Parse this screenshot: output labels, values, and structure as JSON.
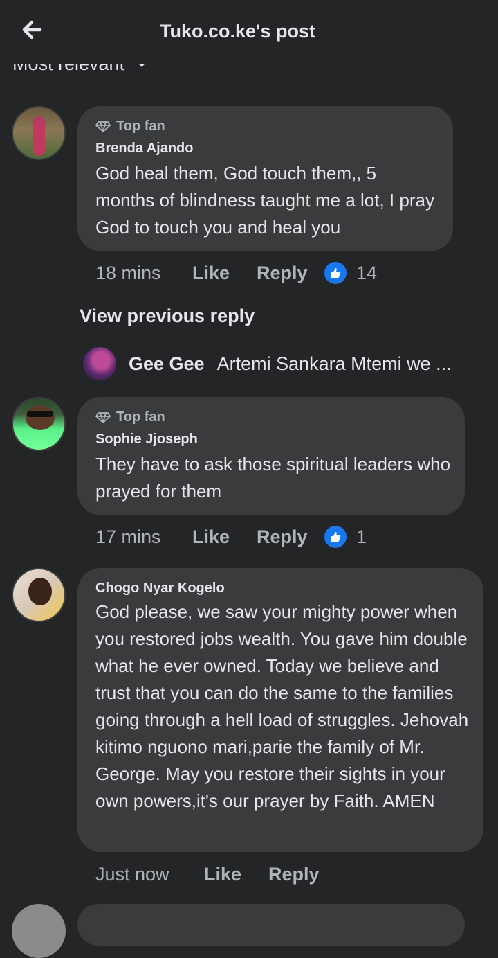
{
  "header": {
    "title": "Tuko.co.ke's post",
    "sort_label": "Most relevant"
  },
  "comments": [
    {
      "badge": "Top fan",
      "author": "Brenda Ajando",
      "text": "God heal them, God touch them,, 5 months of blindness  taught me a lot, I pray God to touch you  and heal you",
      "time": "18 mins",
      "like_label": "Like",
      "reply_label": "Reply",
      "reactions": "14"
    },
    {
      "badge": "Top fan",
      "author": "Sophie Jjoseph",
      "text": "They have to ask those spiritual leaders who prayed for them",
      "time": "17 mins",
      "like_label": "Like",
      "reply_label": "Reply",
      "reactions": "1"
    },
    {
      "author": "Chogo Nyar Kogelo",
      "text": "God please, we saw your mighty power when you restored jobs wealth. You gave him double what he ever owned. Today we believe and trust that you can do the same to the families going through a hell load of struggles. Jehovah kitimo nguono mari,parie the family of Mr. George. May you restore their sights in your own powers,it's our prayer by Faith. AMEN",
      "time": "Just now",
      "like_label": "Like",
      "reply_label": "Reply"
    }
  ],
  "replies": {
    "view_previous": "View previous reply",
    "author": "Gee Gee",
    "preview": "Artemi Sankara Mtemi we ..."
  },
  "colors": {
    "background": "#242526",
    "bubble": "#3a3b3c",
    "like_blue": "#1877f2"
  }
}
